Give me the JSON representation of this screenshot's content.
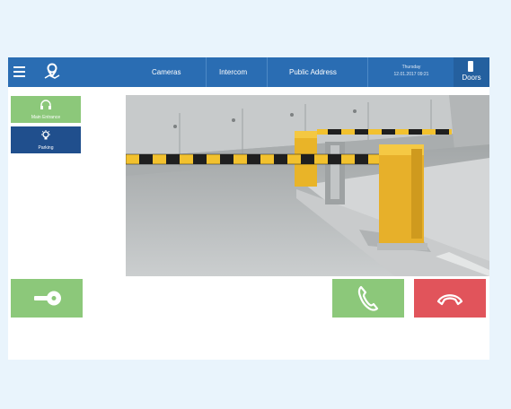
{
  "topbar": {
    "menu_icon": "hamburger-menu-icon",
    "map_icon": "map-pin-icon",
    "nav": [
      {
        "label": "Cameras"
      },
      {
        "label": "Intercom"
      },
      {
        "label": "Public Address"
      }
    ],
    "datetime": {
      "day": "Thursday",
      "stamp": "12.01.2017 09:21"
    },
    "doors": {
      "icon": "door-icon",
      "label": "Doors"
    },
    "color": "#2a6db3"
  },
  "sidebar": {
    "items": [
      {
        "label": "Main Entrance",
        "icon": "headset-icon",
        "color": "#8cc87a",
        "selected": false
      },
      {
        "label": "Parking",
        "icon": "light-bulb-icon",
        "color": "#204f8d",
        "selected": true
      }
    ]
  },
  "video": {
    "content": "parking barrier camera feed"
  },
  "actions": {
    "unlock": {
      "icon": "key-unlock-icon",
      "color": "#8cc87a"
    },
    "answer": {
      "icon": "phone-answer-icon",
      "color": "#8cc87a"
    },
    "hangup": {
      "icon": "phone-hangup-icon",
      "color": "#e1545b"
    }
  }
}
